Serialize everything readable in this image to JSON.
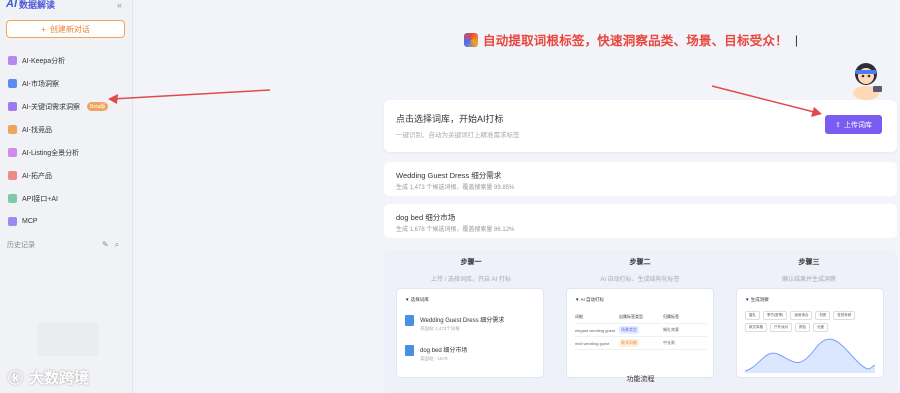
{
  "sidebar": {
    "brand_logo": "AI",
    "brand_name": "数据解读",
    "new_chat_label": "创建新对话",
    "items": [
      {
        "label": "AI-Keepa分析",
        "color": "#b58af0"
      },
      {
        "label": "AI-市场洞察",
        "color": "#5b8def"
      },
      {
        "label": "AI-关键词需求洞察",
        "color": "#9b7cf0",
        "badge": "Beta版"
      },
      {
        "label": "AI-找竞品",
        "color": "#f0a35c"
      },
      {
        "label": "AI-Listing全景分析",
        "color": "#d08af0"
      },
      {
        "label": "AI-拓产品",
        "color": "#f08a8a"
      },
      {
        "label": "API接口+AI",
        "color": "#7fc8a9"
      },
      {
        "label": "MCP",
        "color": "#9b8af0"
      }
    ],
    "history_label": "历史记录"
  },
  "watermark": "大数跨境",
  "banner": {
    "text": "自动提取词根标签，快速洞察品类、场景、目标受众！",
    "caret": "|"
  },
  "upload_card": {
    "title": "点击选择词库，开始AI打标",
    "subtitle": "一键识别、自动为关键词打上精准需求标签",
    "button_label": "上传词库"
  },
  "history_cards": [
    {
      "title": "Wedding Guest Dress 细分需求",
      "subtitle": "生成 1,473 个候选词根，覆盖搜索量 99.85%"
    },
    {
      "title": "dog bed 细分市场",
      "subtitle": "生成 1,678 个候选词根，覆盖搜索量 86.12%"
    }
  ],
  "steps": [
    {
      "title": "步骤一",
      "subtitle": "上传 / 选择词库，开启 AI 打标"
    },
    {
      "title": "步骤二",
      "subtitle": "AI 自动打标、生成结构化标签"
    },
    {
      "title": "步骤三",
      "subtitle": "确认结果并生成洞察"
    }
  ],
  "panels": {
    "p1": {
      "header": "选择词库",
      "items": [
        {
          "title": "Wedding Guest Dress 细分需求",
          "sub": "英国站·1,473个词根"
        },
        {
          "title": "dog bed 细分市场",
          "sub": "美国站 · 1678"
        }
      ]
    },
    "p2": {
      "header": "AI 自动打标",
      "cols": [
        "词根",
        "自属标签类型",
        "归属标签"
      ],
      "rows": [
        {
          "a": "elegant wedding guest",
          "b": "场景类型",
          "c": "婚礼宾客"
        },
        {
          "a": "midi wedding guest",
          "b": "款式风格",
          "c": "中长款"
        }
      ]
    },
    "p3": {
      "header": "生成洞察",
      "chips": [
        "婚礼",
        "季节(夏季)",
        "适用场合",
        "材质",
        "性别年龄",
        "款式风格",
        "户外派对",
        "颜色",
        "长度"
      ]
    }
  },
  "flow_label": "功能流程",
  "colors": {
    "accent": "#7b5cf0",
    "banner": "#e8453c",
    "orange": "#f0a35c"
  }
}
